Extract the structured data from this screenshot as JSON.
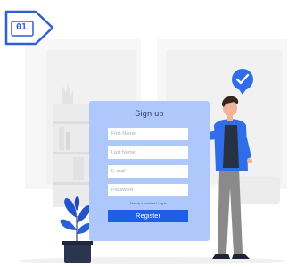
{
  "step_badge": {
    "number": "01"
  },
  "signup_form": {
    "title": "Sign up",
    "fields": [
      {
        "placeholder": "First Name"
      },
      {
        "placeholder": "Last Name"
      },
      {
        "placeholder": "E-mail"
      },
      {
        "placeholder": "Password"
      }
    ],
    "member_text": "Already a member?",
    "login_label": "Log in",
    "register_label": "Register"
  },
  "colors": {
    "accent": "#1f5fe6",
    "card": "#aec8fb",
    "check_badge": "#2f6ee8",
    "jacket": "#2f6ee8",
    "plant": "#2352c9"
  },
  "icons": [
    "step-badge-icon",
    "check-badge-icon",
    "plant-icon",
    "person-illustration",
    "bookshelf-illustration",
    "window-illustration"
  ]
}
